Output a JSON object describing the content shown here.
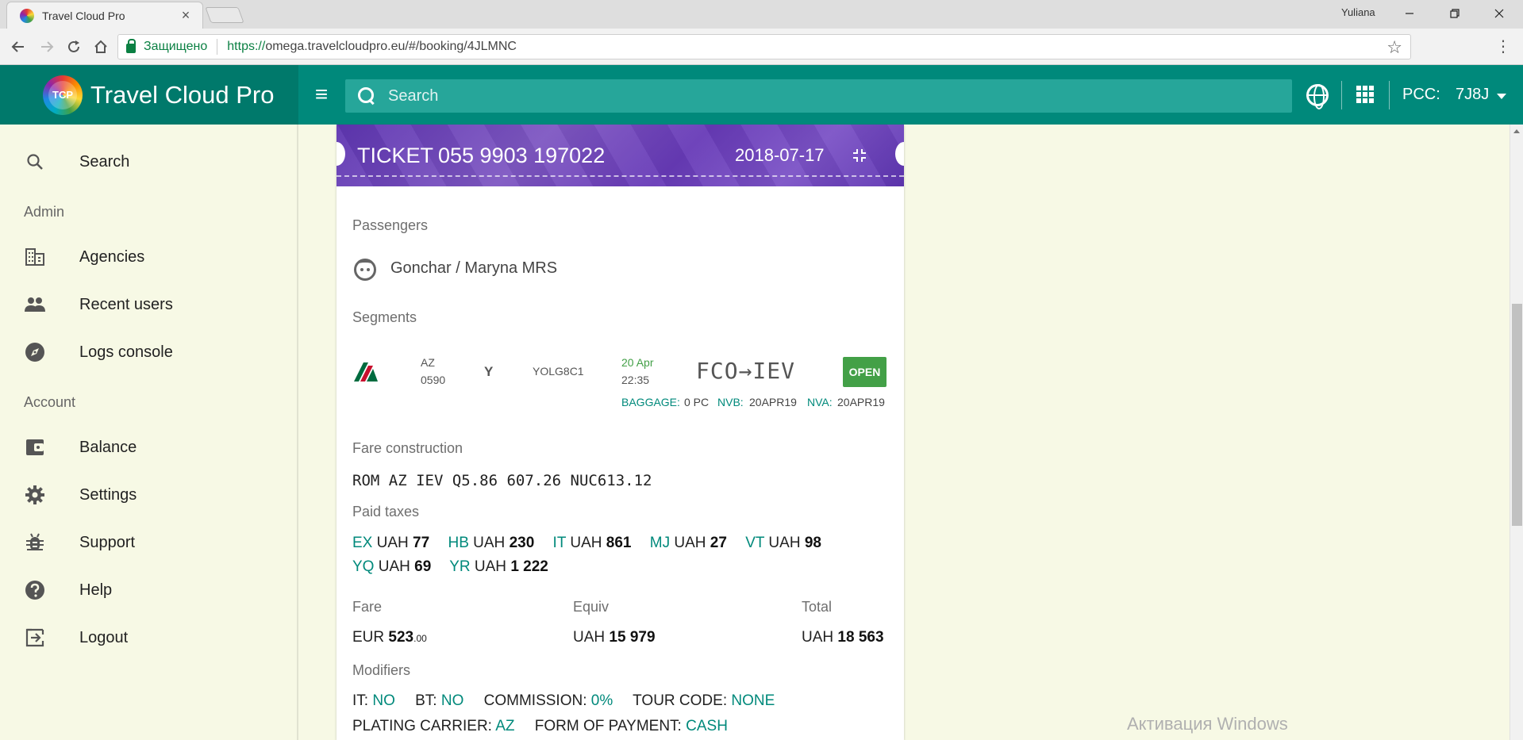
{
  "browser": {
    "tab_title": "Travel Cloud Pro",
    "tab_close": "×",
    "window_user": "Yuliana",
    "secure_label": "Защищено",
    "url_protocol": "https://",
    "url_rest": "omega.travelcloudpro.eu/#/booking/4JLMNC"
  },
  "header": {
    "brand_name": "Travel Cloud Pro",
    "logo_text": "TCP",
    "search_placeholder": "Search",
    "pcc_label": "PCC:",
    "pcc_value": "7J8J",
    "accent_color": "#00897b"
  },
  "sidebar": {
    "items_top": [
      {
        "label": "Search",
        "icon": "search-icon"
      }
    ],
    "section_admin": "Admin",
    "items_admin": [
      {
        "label": "Agencies",
        "icon": "building-icon"
      },
      {
        "label": "Recent users",
        "icon": "people-icon"
      },
      {
        "label": "Logs console",
        "icon": "compass-icon"
      }
    ],
    "section_account": "Account",
    "items_account": [
      {
        "label": "Balance",
        "icon": "wallet-icon"
      },
      {
        "label": "Settings",
        "icon": "gear-icon"
      },
      {
        "label": "Support",
        "icon": "bug-icon"
      },
      {
        "label": "Help",
        "icon": "help-icon"
      },
      {
        "label": "Logout",
        "icon": "logout-icon"
      }
    ]
  },
  "ticket": {
    "title": "TICKET",
    "number": "055 9903 197022",
    "date": "2018-07-17",
    "passengers_label": "Passengers",
    "passenger_name": "Gonchar / Maryna MRS",
    "segments_label": "Segments",
    "segment": {
      "airline_code": "AZ",
      "flight_number": "0590",
      "booking_class": "Y",
      "fare_basis": "YOLG8C1",
      "date": "20 Apr",
      "time": "22:35",
      "route": "FCO→IEV",
      "status": "OPEN",
      "baggage_label": "BAGGAGE:",
      "baggage_value": "0 PC",
      "nvb_label": "NVB:",
      "nvb_value": "20APR19",
      "nva_label": "NVA:",
      "nva_value": "20APR19"
    },
    "fare_construction_label": "Fare construction",
    "fare_construction": "ROM AZ IEV Q5.86 607.26 NUC613.12",
    "paid_taxes_label": "Paid taxes",
    "taxes_row1": [
      {
        "code": "EX",
        "currency": "UAH",
        "amount": "77"
      },
      {
        "code": "HB",
        "currency": "UAH",
        "amount": "230"
      },
      {
        "code": "IT",
        "currency": "UAH",
        "amount": "861"
      },
      {
        "code": "MJ",
        "currency": "UAH",
        "amount": "27"
      },
      {
        "code": "VT",
        "currency": "UAH",
        "amount": "98"
      }
    ],
    "taxes_row2": [
      {
        "code": "YQ",
        "currency": "UAH",
        "amount": "69"
      },
      {
        "code": "YR",
        "currency": "UAH",
        "amount": "1 222"
      }
    ],
    "fare_label": "Fare",
    "fare_currency": "EUR",
    "fare_amount": "523",
    "fare_decimals": ".00",
    "equiv_label": "Equiv",
    "equiv_currency": "UAH",
    "equiv_amount": "15 979",
    "total_label": "Total",
    "total_currency": "UAH",
    "total_amount": "18 563",
    "modifiers_label": "Modifiers",
    "modifiers_row1": [
      {
        "label": "IT:",
        "value": "NO"
      },
      {
        "label": "BT:",
        "value": "NO"
      },
      {
        "label": "COMMISSION:",
        "value": "0%"
      },
      {
        "label": "TOUR CODE:",
        "value": "NONE"
      }
    ],
    "modifiers_row2": [
      {
        "label": "PLATING CARRIER:",
        "value": "AZ"
      },
      {
        "label": "FORM OF PAYMENT:",
        "value": "CASH"
      }
    ]
  },
  "watermark": "Активация Windows"
}
